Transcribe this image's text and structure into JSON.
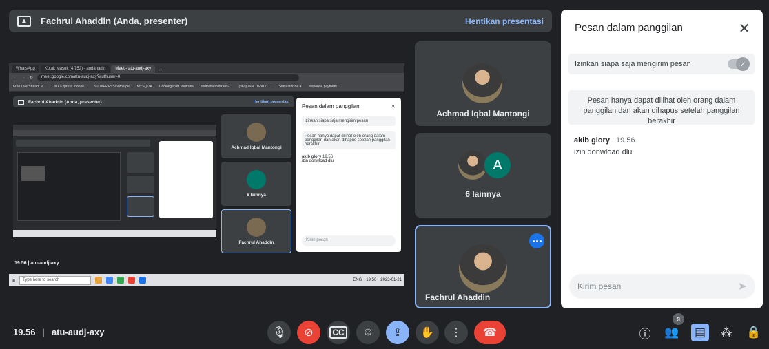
{
  "presenter": {
    "title": "Fachrul Ahaddin (Anda, presenter)",
    "stop_label": "Hentikan presentasi"
  },
  "shared_screen": {
    "tabs": [
      "WhatsApp",
      "Kotak Masuk (4.752) - andahadin",
      "Meet - atu-audj-axy"
    ],
    "url": "meet.google.com/atu-audj-axy?authuser=0",
    "bookmarks": [
      "Free Live Stream M...",
      "J&T Express Indone...",
      "STOKPRESS/home-pkl",
      "MYSQLIA",
      "Cookiegenier Midtrans",
      "Midtrans/midtrans-...",
      "(369) INNOTRAD C...",
      "Simulator BCA",
      "response payment"
    ],
    "inner_title": "Fachrul Ahaddin (Anda, presenter)",
    "inner_stop": "Hentikan presentasi",
    "tiles": [
      "Achmad Iqbal Mantongi",
      "6 lainnya",
      "Fachrul Ahaddin"
    ],
    "chat": {
      "title": "Pesan dalam panggilan",
      "permission": "Izinkan siapa saja mengirim pesan",
      "notice": "Pesan hanya dapat dilihat oleh orang dalam panggilan dan akan dihapus setelah panggilan berakhir",
      "sender": "akib glory",
      "time": "19.56",
      "message": "izin donwload dlu",
      "input_placeholder": "Kirim pesan"
    },
    "meeting_info": "19.56 | atu-audj-axy",
    "taskbar_search": "Type here to search",
    "taskbar_time": "19.56",
    "taskbar_date": "2023-01-21",
    "taskbar_lang": "ENG"
  },
  "tiles": {
    "tile1": {
      "name": "Achmad Iqbal Mantongi"
    },
    "tile2": {
      "name": "6 lainnya",
      "letter": "A"
    },
    "tile3": {
      "name": "Fachrul Ahaddin"
    }
  },
  "chat": {
    "title": "Pesan dalam panggilan",
    "permission": "Izinkan siapa saja mengirim pesan",
    "notice": "Pesan hanya dapat dilihat oleh orang dalam panggilan dan akan dihapus setelah panggilan berakhir",
    "messages": [
      {
        "sender": "akib glory",
        "time": "19.56",
        "text": "izin donwload dlu"
      }
    ],
    "input_placeholder": "Kirim pesan",
    "permission_enabled": true
  },
  "bottom": {
    "time": "19.56",
    "meeting_code": "atu-audj-axy",
    "participants_count": "9"
  },
  "colors": {
    "background": "#202124",
    "tile": "#3c4043",
    "accent_blue": "#8ab4f8",
    "end_call_red": "#ea4335"
  }
}
